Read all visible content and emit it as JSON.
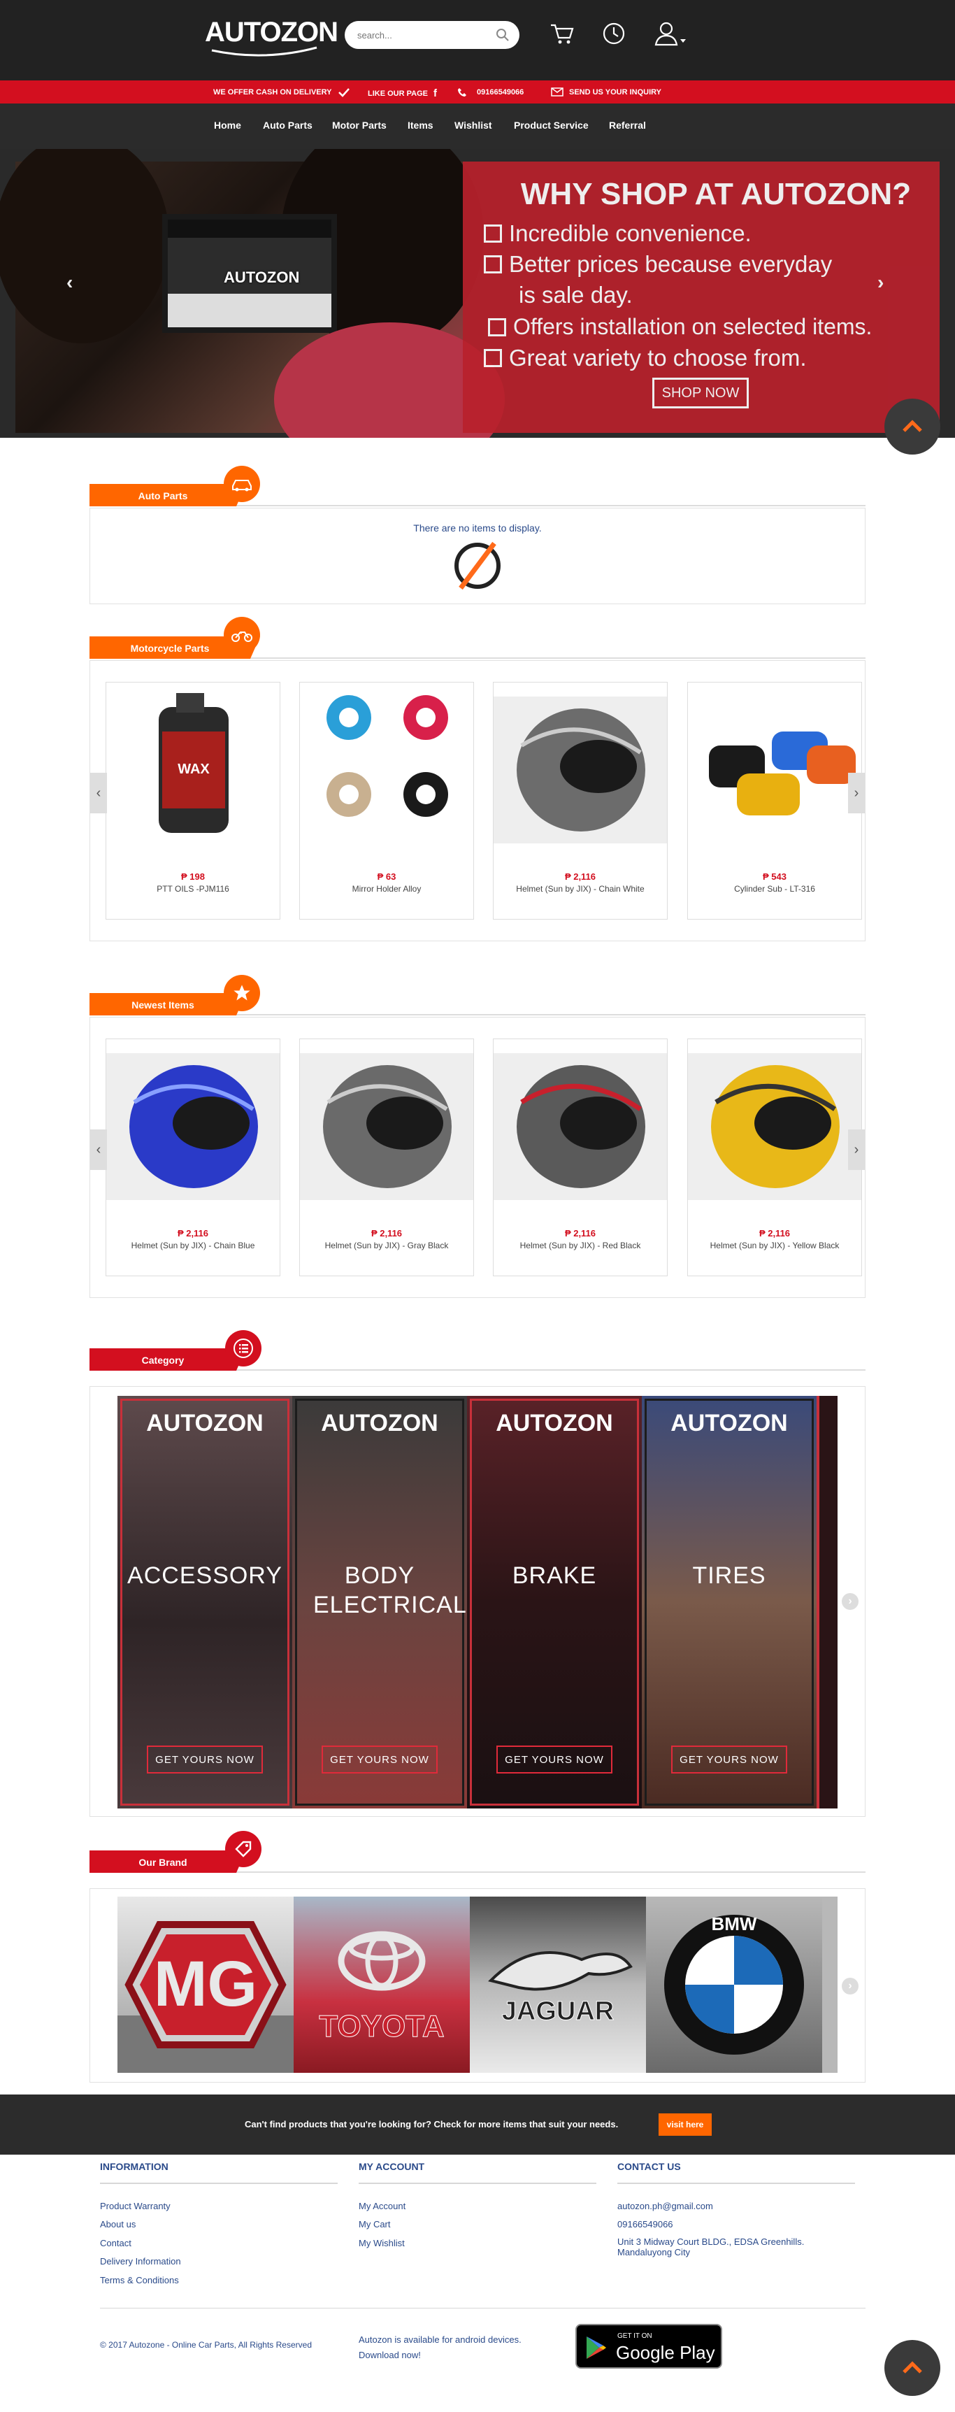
{
  "header": {
    "logo": "AUTOZON",
    "search_placeholder": "search..."
  },
  "topbar": {
    "cod": "WE OFFER CASH ON DELIVERY",
    "like": "LIKE OUR PAGE",
    "phone": "09166549066",
    "inquiry": "SEND US YOUR INQUIRY"
  },
  "nav": [
    "Home",
    "Auto Parts",
    "Motor Parts",
    "Items",
    "Wishlist",
    "Product Service",
    "Referral"
  ],
  "hero": {
    "screen_logo": "AUTOZON",
    "title": "WHY SHOP AT AUTOZON?",
    "features": [
      "Incredible convenience.",
      "Better prices because everyday",
      "is sale day.",
      "Offers installation on selected items.",
      "Great variety to choose from."
    ],
    "cta": "SHOP NOW"
  },
  "auto_parts": {
    "title": "Auto Parts",
    "empty": "There are no items to display."
  },
  "motorcycle_parts": {
    "title": "Motorcycle Parts",
    "items": [
      {
        "price": "₱ 198",
        "name": "PTT OILS -PJM116",
        "color": "#a8201c"
      },
      {
        "price": "₱ 63",
        "name": "Mirror Holder Alloy",
        "color": "#2a9fd8"
      },
      {
        "price": "₱ 2,116",
        "name": "Helmet (Sun by JIX) - Chain White",
        "color": "#6c6c6c"
      },
      {
        "price": "₱ 543",
        "name": "Cylinder Sub - LT-316",
        "color": "#e8b010"
      }
    ]
  },
  "newest_items": {
    "title": "Newest Items",
    "items": [
      {
        "price": "₱ 2,116",
        "name": "Helmet (Sun by JIX) - Chain Blue",
        "color": "#2a3ac8"
      },
      {
        "price": "₱ 2,116",
        "name": "Helmet (Sun by JIX) - Gray Black",
        "color": "#6a6a6a"
      },
      {
        "price": "₱ 2,116",
        "name": "Helmet (Sun by JIX) - Red Black",
        "color": "#c8202c"
      },
      {
        "price": "₱ 2,116",
        "name": "Helmet (Sun by JIX) - Yellow Black",
        "color": "#e8b818"
      }
    ]
  },
  "category": {
    "title": "Category",
    "items": [
      {
        "logo": "AUTOZON",
        "name": "ACCESSORY",
        "cta": "GET YOURS NOW",
        "frame": "#c8303a",
        "bg": "#4a3e40"
      },
      {
        "logo": "AUTOZON",
        "name": "BODY ELECTRICAL",
        "cta": "GET YOURS NOW",
        "frame": "#1c1c1c",
        "bg": "#5a3a38"
      },
      {
        "logo": "AUTOZON",
        "name": "BRAKE",
        "cta": "GET YOURS NOW",
        "frame": "#c8303a",
        "bg": "#3a2224"
      },
      {
        "logo": "AUTOZON",
        "name": "TIRES",
        "cta": "GET YOURS NOW",
        "frame": "#1c1c1c",
        "bg": "#6a4a40"
      }
    ]
  },
  "brands": {
    "title": "Our Brand",
    "items": [
      {
        "name": "MG",
        "color": "#c8202c"
      },
      {
        "name": "TOYOTA",
        "color": "#c8202c"
      },
      {
        "name": "JAGUAR",
        "color": "#222222"
      },
      {
        "name": "BMW",
        "color": "#1c6ab8"
      }
    ]
  },
  "promo": {
    "text": "Can't find products that you're looking for? Check for more items that suit your needs.",
    "button": "visit here"
  },
  "footer": {
    "information": {
      "title": "INFORMATION",
      "links": [
        "Product Warranty",
        "About us",
        "Contact",
        "Delivery Information",
        "Terms & Conditions"
      ]
    },
    "account": {
      "title": "MY ACCOUNT",
      "links": [
        "My Account",
        "My Cart",
        "My Wishlist"
      ]
    },
    "contact": {
      "title": "CONTACT US",
      "email": "autozon.ph@gmail.com",
      "phone": "09166549066",
      "address": "Unit 3 Midway Court BLDG., EDSA Greenhills. Mandaluyong City"
    },
    "copyright": "© 2017 Autozone - Online Car Parts, All Rights Reserved",
    "app_line1": "Autozon is available for android devices.",
    "app_line2": "Download now!",
    "play_small": "GET IT ON",
    "play_big": "Google Play"
  }
}
